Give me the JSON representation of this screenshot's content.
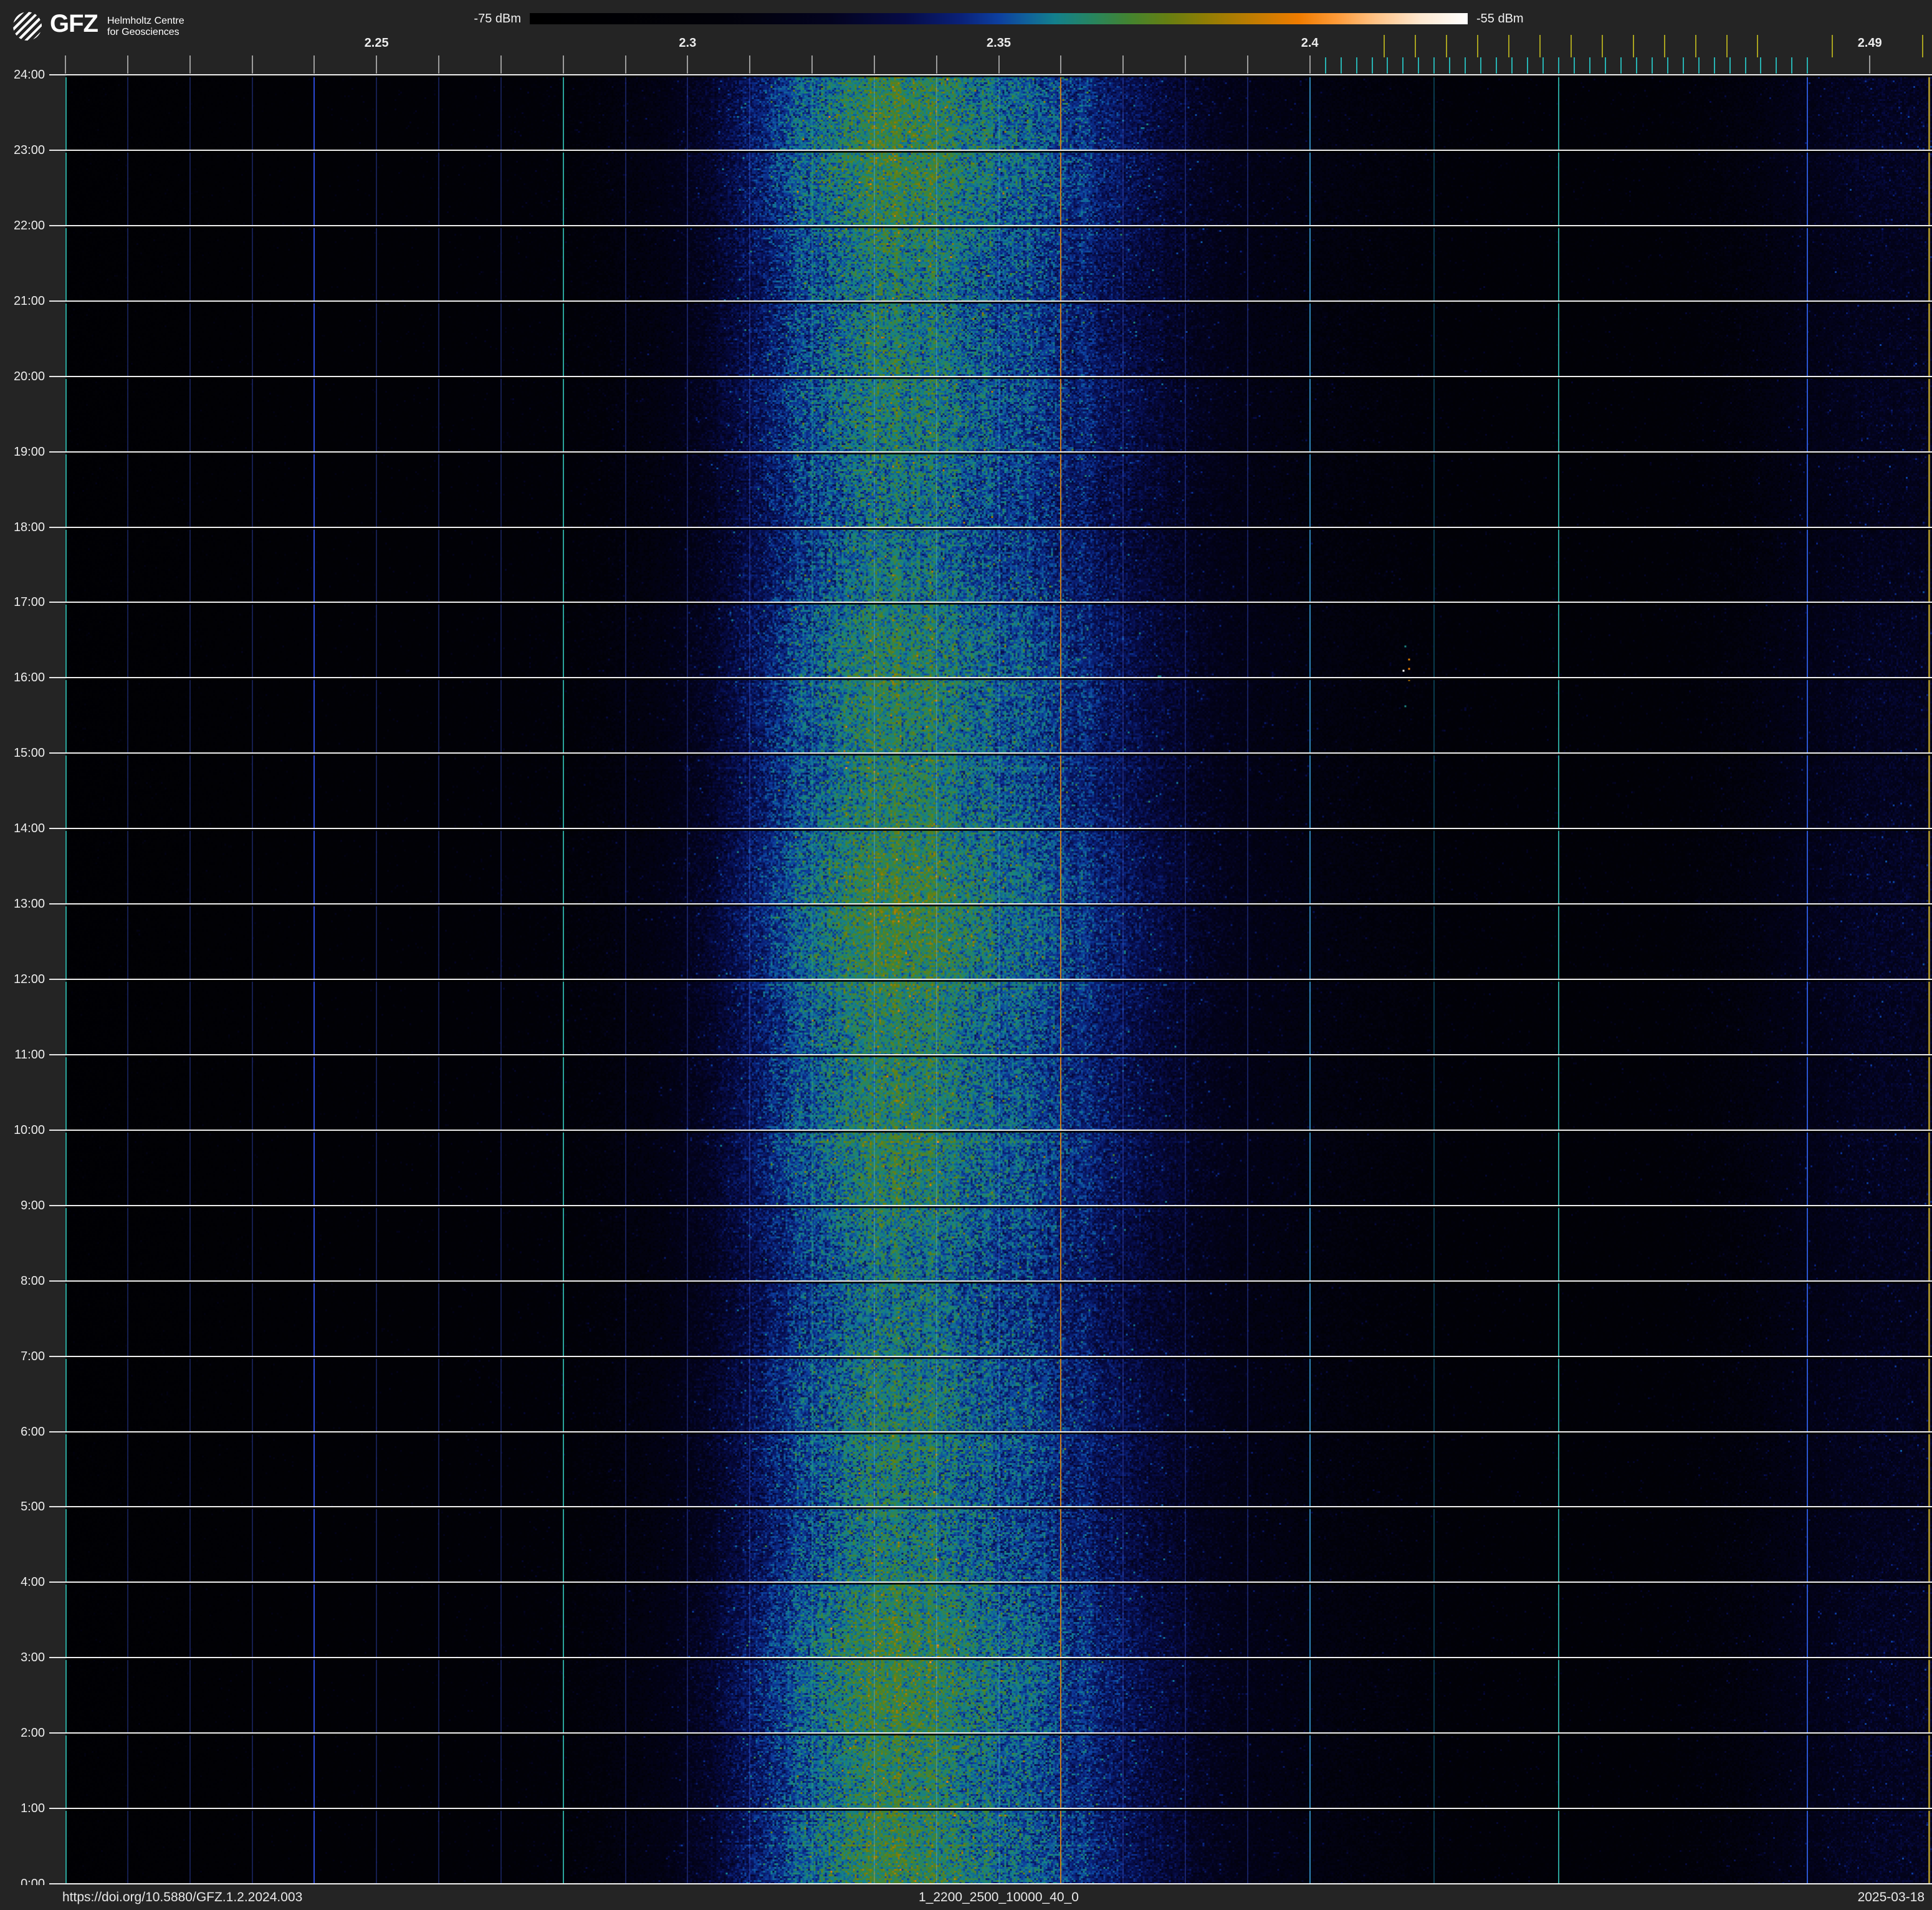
{
  "header": {
    "logo": {
      "acronym": "GFZ",
      "subtitle_line1": "Helmholtz Centre",
      "subtitle_line2": "for Geosciences"
    },
    "colorbar": {
      "min_label": "-75 dBm",
      "max_label": "-55 dBm",
      "stops": [
        {
          "p": 0.0,
          "c": "#000000"
        },
        {
          "p": 0.2,
          "c": "#010108"
        },
        {
          "p": 0.32,
          "c": "#03031e"
        },
        {
          "p": 0.4,
          "c": "#060b46"
        },
        {
          "p": 0.46,
          "c": "#0a2178"
        },
        {
          "p": 0.5,
          "c": "#0d3f9e"
        },
        {
          "p": 0.53,
          "c": "#10619b"
        },
        {
          "p": 0.56,
          "c": "#13808c"
        },
        {
          "p": 0.6,
          "c": "#27855f"
        },
        {
          "p": 0.64,
          "c": "#44842f"
        },
        {
          "p": 0.68,
          "c": "#667f12"
        },
        {
          "p": 0.72,
          "c": "#8f7d04"
        },
        {
          "p": 0.77,
          "c": "#bf7c01"
        },
        {
          "p": 0.82,
          "c": "#f07c00"
        },
        {
          "p": 0.86,
          "c": "#fe9a38"
        },
        {
          "p": 0.9,
          "c": "#ffc183"
        },
        {
          "p": 0.95,
          "c": "#ffe9d1"
        },
        {
          "p": 1.0,
          "c": "#ffffff"
        }
      ]
    }
  },
  "freq_axis": {
    "range_ghz": [
      2.2,
      2.5
    ],
    "minor_ticks": {
      "start": 2.2,
      "end": 2.4,
      "step": 0.01
    },
    "extra_ticks": [
      2.49
    ],
    "labels": [
      {
        "v": 2.25,
        "label": "2.25"
      },
      {
        "v": 2.3,
        "label": "2.3"
      },
      {
        "v": 2.35,
        "label": "2.35"
      },
      {
        "v": 2.4,
        "label": "2.4"
      },
      {
        "v": 2.49,
        "label": "2.49"
      }
    ],
    "wifi_band_ticks": {
      "cyan": {
        "start": 2.4025,
        "end": 2.48,
        "step": 0.0025,
        "color": "#27b2b2"
      },
      "yellow": {
        "positions": [
          2.412,
          2.417,
          2.422,
          2.427,
          2.432,
          2.437,
          2.442,
          2.447,
          2.452,
          2.457,
          2.462,
          2.467,
          2.472,
          2.484,
          2.4985
        ],
        "color": "#a8a21f"
      }
    }
  },
  "time_axis": {
    "labels": [
      "24:00",
      "23:00",
      "22:00",
      "21:00",
      "20:00",
      "19:00",
      "18:00",
      "17:00",
      "16:00",
      "15:00",
      "14:00",
      "13:00",
      "12:00",
      "11:00",
      "10:00",
      "9:00",
      "8:00",
      "7:00",
      "6:00",
      "5:00",
      "4:00",
      "3:00",
      "2:00",
      "1:00",
      "0:00"
    ]
  },
  "plot": {
    "background": "#000000",
    "hour_gridline_color": "#efefef",
    "vertical_gridlines": [
      {
        "f": 2.2,
        "color": "#2aa39a",
        "width": 2,
        "opacity": 1
      },
      {
        "f": 2.24,
        "color": "#2d49d4",
        "width": 2,
        "opacity": 1
      },
      {
        "f": 2.28,
        "color": "#2aa39a",
        "width": 2,
        "opacity": 1
      },
      {
        "f": 2.32,
        "color": "#2aa39a",
        "width": 2,
        "opacity": 0.35
      },
      {
        "f": 2.36,
        "color": "#c87a1e",
        "width": 2,
        "opacity": 1
      },
      {
        "f": 2.4,
        "color": "#2f86b8",
        "width": 2,
        "opacity": 1
      },
      {
        "f": 2.42,
        "color": "#0d5066",
        "width": 2,
        "opacity": 0.75
      },
      {
        "f": 2.44,
        "color": "#2aa39a",
        "width": 2,
        "opacity": 1
      },
      {
        "f": 2.48,
        "color": "#2a55d0",
        "width": 2,
        "opacity": 1
      },
      {
        "f": 2.4995,
        "color": "#a08a28",
        "width": 3,
        "opacity": 1
      }
    ],
    "faint_gridlines": {
      "start": 2.21,
      "end": 2.39,
      "step": 0.01,
      "skip": [
        2.24,
        2.28,
        2.32,
        2.36
      ],
      "color": "#18245e"
    }
  },
  "footer": {
    "doi": "https://doi.org/10.5880/GFZ.1.2.2024.003",
    "filename": "1_2200_2500_10000_40_0",
    "date": "2025-03-18"
  },
  "chart_data": {
    "type": "heatmap",
    "title": "",
    "x_axis": {
      "tick_labels": [
        "2.25",
        "2.3",
        "2.35",
        "2.4",
        "2.49"
      ],
      "range_ghz": [
        2.2,
        2.5
      ]
    },
    "y_axis": {
      "tick_labels": [
        "24:00",
        "23:00",
        "22:00",
        "21:00",
        "20:00",
        "19:00",
        "18:00",
        "17:00",
        "16:00",
        "15:00",
        "14:00",
        "13:00",
        "12:00",
        "11:00",
        "10:00",
        "9:00",
        "8:00",
        "7:00",
        "6:00",
        "5:00",
        "4:00",
        "3:00",
        "2:00",
        "1:00",
        "0:00"
      ],
      "range_hours": [
        0,
        24
      ]
    },
    "intensity_scale_dbm": {
      "min": -75,
      "max": -55
    },
    "legend_position": "top",
    "grid": "hourly horizontal lines; colored vertical lines every 40 MHz",
    "spectral_profile": {
      "frequency_ghz": [
        2.2,
        2.24,
        2.262,
        2.285,
        2.296,
        2.304,
        2.311,
        2.318,
        2.324,
        2.329,
        2.334,
        2.341,
        2.348,
        2.355,
        2.362,
        2.369,
        2.377,
        2.385,
        2.393,
        2.403,
        2.412,
        2.425,
        2.44,
        2.455,
        2.468,
        2.478,
        2.488,
        2.5
      ],
      "mean_level_dbm": [
        -73.0,
        -72.4,
        -71.8,
        -70.8,
        -69.8,
        -68.2,
        -66.4,
        -65.0,
        -64.0,
        -63.3,
        -63.1,
        -63.7,
        -64.3,
        -64.9,
        -65.8,
        -66.7,
        -67.8,
        -69.0,
        -69.8,
        -70.3,
        -70.7,
        -71.2,
        -71.4,
        -71.3,
        -70.6,
        -69.6,
        -68.7,
        -68.7
      ]
    },
    "transient_features": [
      {
        "frequency_ghz": 2.4148,
        "time_hours": 16.1,
        "level_dbm": -55.0
      },
      {
        "frequency_ghz": 2.4158,
        "time_hours": 16.25,
        "level_dbm": -59.0
      },
      {
        "frequency_ghz": 2.4158,
        "time_hours": 16.12,
        "level_dbm": -58.5
      },
      {
        "frequency_ghz": 2.4158,
        "time_hours": 15.98,
        "level_dbm": -59.5
      },
      {
        "frequency_ghz": 2.4153,
        "time_hours": 16.42,
        "level_dbm": -63.5
      },
      {
        "frequency_ghz": 2.4153,
        "time_hours": 15.64,
        "level_dbm": -63.5
      },
      {
        "frequency_ghz": 2.4162,
        "time_hours": 16.0,
        "level_dbm": -66.0
      }
    ]
  }
}
